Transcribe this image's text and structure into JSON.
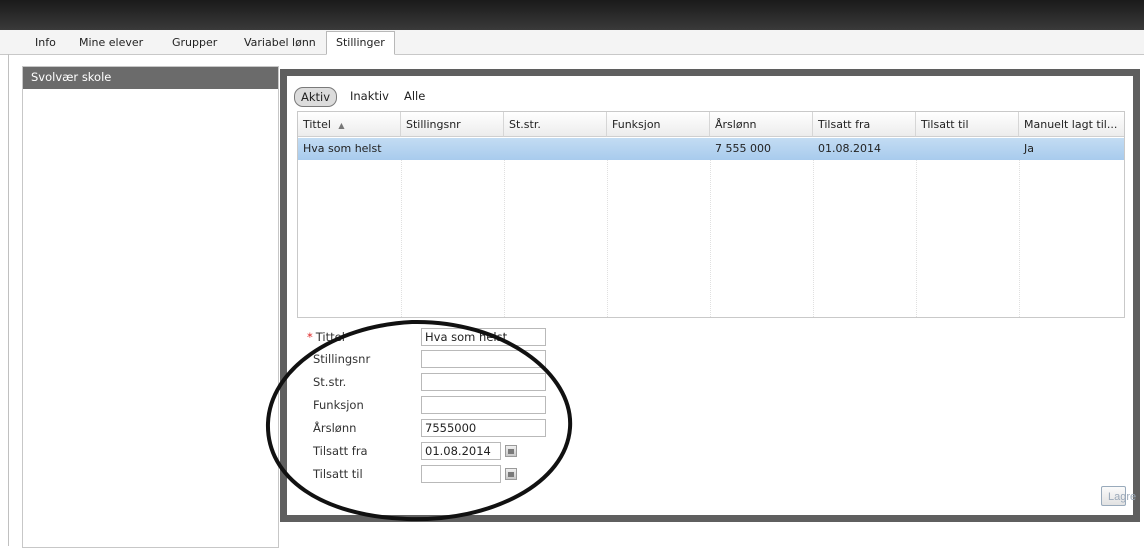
{
  "tabs": [
    "Info",
    "Mine elever",
    "Grupper",
    "Variabel lønn",
    "Stillinger"
  ],
  "sidebar": {
    "header": "Svolvær skole"
  },
  "filters": [
    "Aktiv",
    "Inaktiv",
    "Alle"
  ],
  "table": {
    "columns": [
      "Tittel",
      "Stillingsnr",
      "St.str.",
      "Funksjon",
      "Årslønn",
      "Tilsatt fra",
      "Tilsatt til",
      "Manuelt lagt til..."
    ],
    "rows": [
      [
        "Hva som helst",
        "",
        "",
        "",
        "7 555 000",
        "01.08.2014",
        "",
        "Ja"
      ]
    ]
  },
  "form": {
    "fields": {
      "tittel": {
        "label": "Tittel",
        "value": "Hva som helst"
      },
      "stillingsnr": {
        "label": "Stillingsnr",
        "value": ""
      },
      "ststr": {
        "label": "St.str.",
        "value": ""
      },
      "funksjon": {
        "label": "Funksjon",
        "value": ""
      },
      "arslonn": {
        "label": "Årslønn",
        "value": "7555000"
      },
      "tilsatt_fra": {
        "label": "Tilsatt fra",
        "value": "01.08.2014"
      },
      "tilsatt_til": {
        "label": "Tilsatt til",
        "value": ""
      }
    },
    "save_label": "Lagre"
  }
}
